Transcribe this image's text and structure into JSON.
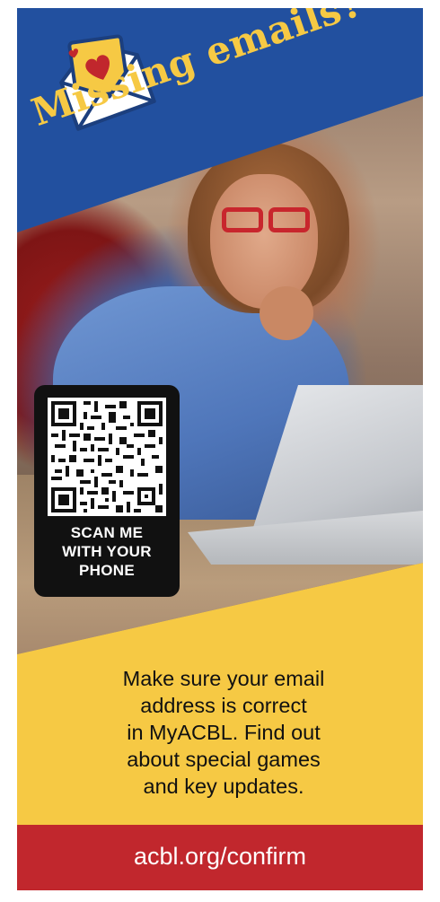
{
  "headline": "Missing emails?",
  "qr": {
    "caption_lines": [
      "SCAN ME",
      "WITH YOUR",
      "PHONE"
    ]
  },
  "body": {
    "lines": [
      "Make sure your email",
      "address is correct",
      "in MyACBL. Find out",
      "about special games",
      "and key updates."
    ]
  },
  "footer": {
    "url": "acbl.org/confirm"
  },
  "colors": {
    "brand_blue": "#22509f",
    "brand_yellow": "#f6c944",
    "brand_red": "#c1272d",
    "ink": "#111111"
  },
  "icons": {
    "mail": "envelope-heart-icon",
    "qr": "qr-code-icon"
  }
}
